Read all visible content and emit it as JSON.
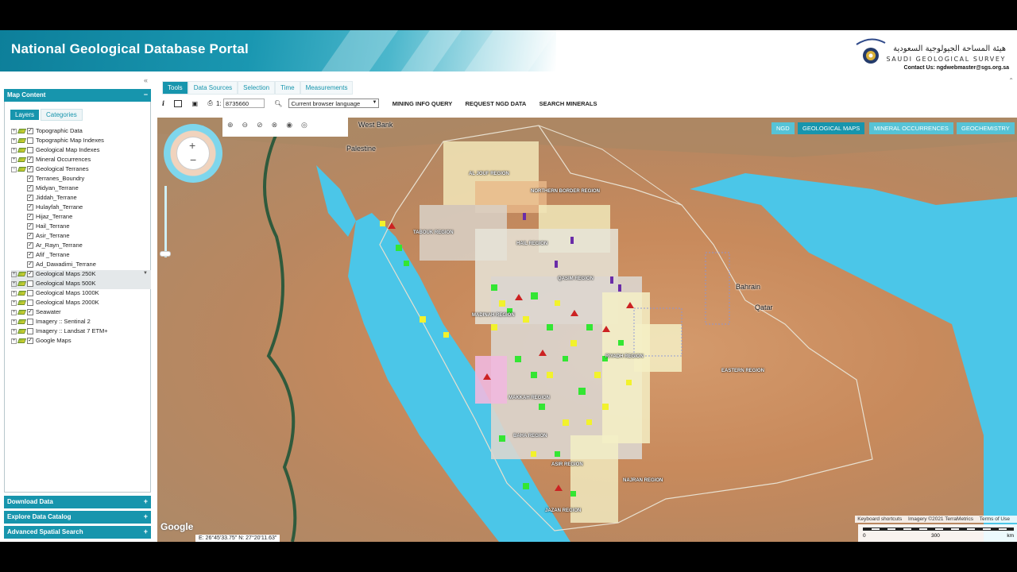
{
  "header": {
    "title": "National Geological Database Portal",
    "logo_arabic": "هيئة المساحة الجيولوجية السعودية",
    "logo_english": "SAUDI GEOLOGICAL SURVEY",
    "contact": "Contact Us: ngdwebmaster@sgs.org.sa"
  },
  "left_panel": {
    "map_content_title": "Map Content",
    "tabs": [
      "Layers",
      "Categories"
    ],
    "layers": [
      {
        "label": "Topographic Data",
        "checked": true,
        "sub": false
      },
      {
        "label": "Topographic Map Indexes",
        "checked": false,
        "sub": false
      },
      {
        "label": "Geological Map Indexes",
        "checked": false,
        "sub": false
      },
      {
        "label": "Mineral Occurrences",
        "checked": true,
        "sub": false
      },
      {
        "label": "Geological Terranes",
        "checked": true,
        "sub": false,
        "expanded": true
      },
      {
        "label": "Terranes_Boundry",
        "checked": true,
        "sub": true
      },
      {
        "label": "Midyan_Terrane",
        "checked": true,
        "sub": true
      },
      {
        "label": "Jiddah_Terrane",
        "checked": true,
        "sub": true
      },
      {
        "label": "Hulayfah_Terrane",
        "checked": true,
        "sub": true
      },
      {
        "label": "Hijaz_Terrane",
        "checked": true,
        "sub": true
      },
      {
        "label": "Hail_Terrane",
        "checked": true,
        "sub": true
      },
      {
        "label": "Asir_Terrane",
        "checked": true,
        "sub": true
      },
      {
        "label": "Ar_Rayn_Terrane",
        "checked": true,
        "sub": true
      },
      {
        "label": "Afif _Terrane",
        "checked": true,
        "sub": true
      },
      {
        "label": "Ad_Dawadimi_Terrane",
        "checked": true,
        "sub": true
      },
      {
        "label": "Geological Maps 250K",
        "checked": true,
        "sub": false,
        "highlight": true
      },
      {
        "label": "Geological Maps 500K",
        "checked": false,
        "sub": false,
        "highlight": true
      },
      {
        "label": "Geological Maps 1000K",
        "checked": false,
        "sub": false
      },
      {
        "label": "Geological Maps 2000K",
        "checked": false,
        "sub": false
      },
      {
        "label": "Seawater",
        "checked": true,
        "sub": false
      },
      {
        "label": "Imagery :: Sentinal 2",
        "checked": false,
        "sub": false
      },
      {
        "label": "Imagery :: Landsat 7 ETM+",
        "checked": false,
        "sub": false
      },
      {
        "label": "Google Maps",
        "checked": true,
        "sub": false
      }
    ],
    "bottom_sections": [
      "Download Data",
      "Explore Data Catalog",
      "Advanced Spatial Search"
    ]
  },
  "toolbar": {
    "tabs": [
      "Tools",
      "Data Sources",
      "Selection",
      "Time",
      "Measurements"
    ],
    "scale_prefix": "1:",
    "scale_value": "8735660",
    "language": "Current browser language",
    "buttons": [
      "MINING INFO QUERY",
      "REQUEST NGD DATA",
      "SEARCH MINERALS"
    ]
  },
  "map": {
    "layer_buttons": [
      "NGD",
      "GEOLOGICAL MAPS",
      "MINERAL OCCURRENCES",
      "GEOCHEMISTRY"
    ],
    "active_layer_button": "GEOLOGICAL MAPS",
    "places": [
      "West Bank",
      "Palestine",
      "Bahrain",
      "Qatar"
    ],
    "regions": [
      "AL JOUF REGION",
      "NORTHERN BORDER REGION",
      "TABOUK REGION",
      "HAIL REGION",
      "QASIM REGION",
      "MADINAH REGION",
      "RIYADH REGION",
      "EASTERN REGION",
      "MAKKAH REGION",
      "BAHA REGION",
      "ASIR REGION",
      "NAJRAN REGION",
      "JAZAN REGION"
    ],
    "google_label": "Google",
    "coordinates": "E: 26°45'33.75\"   N: 27°20'11.63\"",
    "attribution": [
      "Keyboard shortcuts",
      "Imagery ©2021 TerraMetrics",
      "Terms of Use"
    ],
    "scale_labels": [
      "0",
      "300",
      "km"
    ]
  }
}
